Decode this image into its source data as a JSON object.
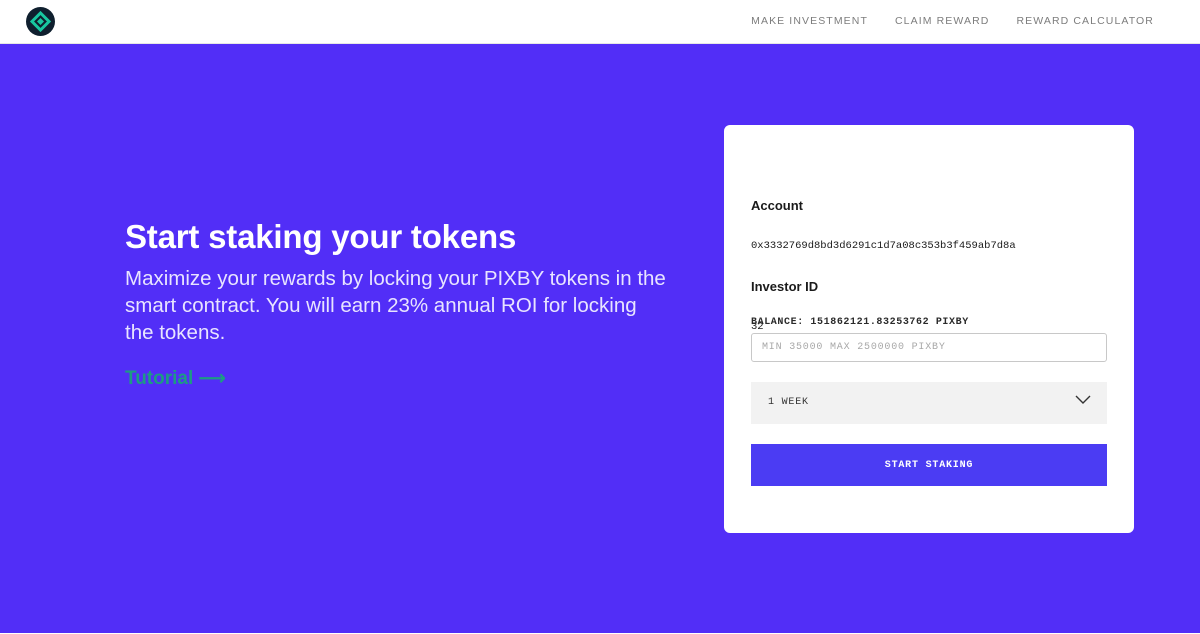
{
  "nav": {
    "logo_icon": "pixby-diamond-logo-icon",
    "links": [
      "MAKE INVESTMENT",
      "CLAIM REWARD",
      "REWARD CALCULATOR"
    ]
  },
  "hero": {
    "title": "Start staking your tokens",
    "description": "Maximize your rewards by locking your PIXBY tokens in the smart contract. You will earn 23% annual ROI for locking the tokens.",
    "tutorial_link": "Tutorial ⟶"
  },
  "card": {
    "account_label": "Account",
    "account_value": "0x3332769d8bd3d6291c1d7a08c353b3f459ab7d8a",
    "investor_label": "Investor ID",
    "investor_value": "32",
    "balance_text": "BALANCE: 151862121.83253762 PIXBY",
    "amount_placeholder": "MIN 35000 MAX 2500000 PIXBY",
    "duration_selected": "1 WEEK",
    "duration_icon": "chevron-down-icon",
    "stake_button": "START STAKING"
  },
  "colors": {
    "hero_background": "#522ef7",
    "button": "#4b3cf3",
    "link": "#1d9a84",
    "logo_background": "#0f1f2e",
    "logo_accent": "#18c7a0"
  }
}
